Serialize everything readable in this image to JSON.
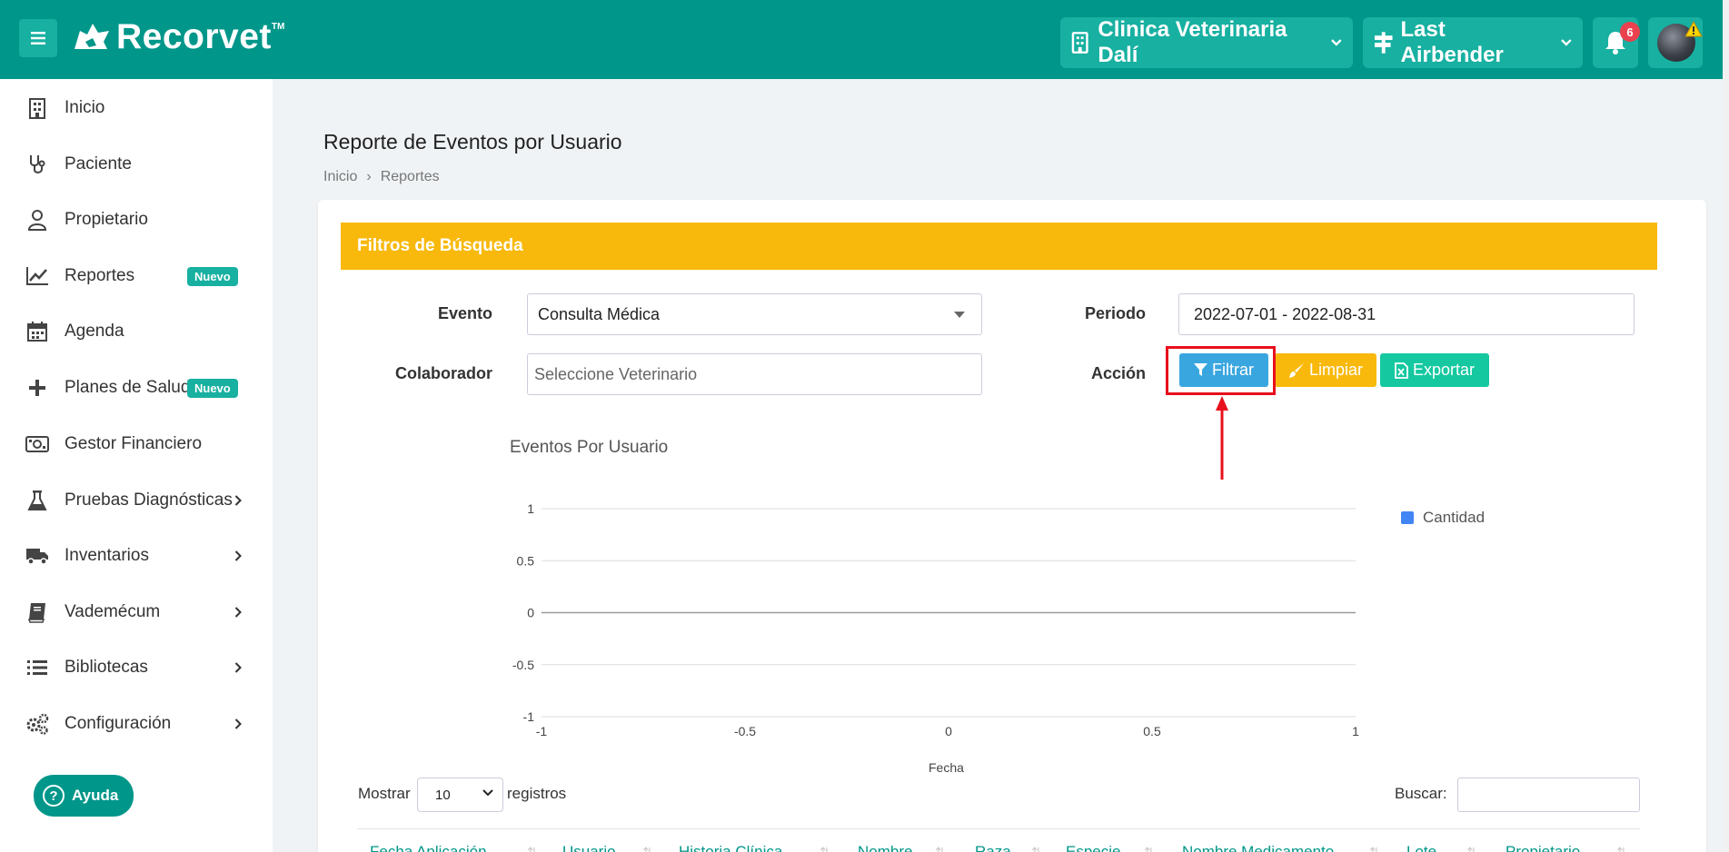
{
  "header": {
    "brand": "Recorvet",
    "brand_tm": "TM",
    "clinic": "Clinica Veterinaria Dalí",
    "user": "Last Airbender",
    "notifications_count": "6",
    "colors": {
      "primary": "#00968a",
      "pill": "#17b0a1",
      "badge": "#e9414e"
    }
  },
  "sidebar": {
    "items": [
      {
        "label": "Inicio",
        "icon": "hospital-icon"
      },
      {
        "label": "Paciente",
        "icon": "stethoscope-icon"
      },
      {
        "label": "Propietario",
        "icon": "user-icon"
      },
      {
        "label": "Reportes",
        "icon": "chart-line-icon",
        "badge": "Nuevo"
      },
      {
        "label": "Agenda",
        "icon": "calendar-icon"
      },
      {
        "label": "Planes de Salud",
        "icon": "plus-icon",
        "badge": "Nuevo"
      },
      {
        "label": "Gestor Financiero",
        "icon": "money-bill-icon"
      },
      {
        "label": "Pruebas Diagnósticas",
        "icon": "flask-icon",
        "has_children": true
      },
      {
        "label": "Inventarios",
        "icon": "truck-icon",
        "has_children": true
      },
      {
        "label": "Vademécum",
        "icon": "book-icon",
        "has_children": true
      },
      {
        "label": "Bibliotecas",
        "icon": "list-icon",
        "has_children": true
      },
      {
        "label": "Configuración",
        "icon": "cogs-icon",
        "has_children": true
      }
    ],
    "help_label": "Ayuda"
  },
  "page": {
    "title": "Reporte de Eventos por Usuario",
    "breadcrumb": [
      "Inicio",
      "Reportes"
    ]
  },
  "filters": {
    "header": "Filtros de Búsqueda",
    "evento_label": "Evento",
    "evento_value": "Consulta Médica",
    "colaborador_label": "Colaborador",
    "colaborador_placeholder": "Seleccione Veterinario",
    "periodo_label": "Periodo",
    "periodo_value": "2022-07-01 - 2022-08-31",
    "accion_label": "Acción",
    "btn_filtrar": "Filtrar",
    "btn_limpiar": "Limpiar",
    "btn_exportar": "Exportar",
    "colors": {
      "header": "#f8b90c",
      "filtrar": "#3aa6e0",
      "limpiar": "#f8b90c",
      "exportar": "#15c8a0",
      "highlight": "#e8101c"
    }
  },
  "chart_data": {
    "type": "line",
    "title": "Eventos Por Usuario",
    "xlabel": "Fecha",
    "ylabel": "",
    "series": [
      {
        "name": "Cantidad",
        "values": [],
        "color": "#4285f4"
      }
    ],
    "xlim": [
      -1,
      1
    ],
    "ylim": [
      -1,
      1
    ],
    "x_ticks": [
      "-1",
      "-0.5",
      "0",
      "0.5",
      "1"
    ],
    "y_ticks": [
      "1",
      "0.5",
      "0",
      "-0.5",
      "-1"
    ],
    "grid": true,
    "legend_position": "right"
  },
  "table": {
    "show_label": "Mostrar",
    "records_label": "registros",
    "page_size": "10",
    "search_label": "Buscar:",
    "columns": [
      "Fecha Aplicación",
      "Usuario",
      "Historia Clínica",
      "Nombre",
      "Raza",
      "Especie",
      "Nombre Medicamento",
      "Lote",
      "Propietario"
    ]
  }
}
